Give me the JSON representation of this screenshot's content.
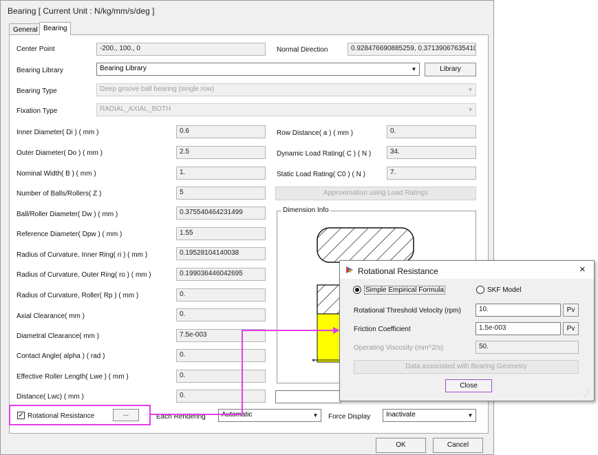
{
  "dialog": {
    "title": "Bearing [ Current Unit : N/kg/mm/s/deg ]",
    "tabs": [
      "General",
      "Bearing"
    ],
    "center_point": {
      "label": "Center Point",
      "value": "-200., 100., 0"
    },
    "normal_direction": {
      "label": "Normal Direction",
      "value": "0.928476690885259, 0.371390676354104,"
    },
    "bearing_library": {
      "label": "Bearing Library",
      "value": "Bearing Library",
      "button": "Library"
    },
    "bearing_type": {
      "label": "Bearing Type",
      "value": "Deep groove ball bearing (single row)"
    },
    "fixation_type": {
      "label": "Fixation Type",
      "value": "RADIAL_AXIAL_BOTH"
    },
    "left_fields": [
      {
        "label": "Inner Diameter( Di ) ( mm )",
        "value": "0.6"
      },
      {
        "label": "Outer Diameter( Do ) ( mm )",
        "value": "2.5"
      },
      {
        "label": "Nominal Width( B ) ( mm )",
        "value": "1."
      },
      {
        "label": "Number of Balls/Rollers( Z )",
        "value": "5"
      },
      {
        "label": "Ball/Roller Diameter( Dw ) ( mm )",
        "value": "0.375540464231499"
      },
      {
        "label": "Reference Diameter( Dpw ) ( mm )",
        "value": "1.55"
      },
      {
        "label": "Radius of Curvature, Inner Ring( ri ) ( mm )",
        "value": "0.19528104140038"
      },
      {
        "label": "Radius of Curvature, Outer Ring( ro ) ( mm )",
        "value": "0.199036446042695"
      },
      {
        "label": "Radius of Curvature, Roller( Rp ) ( mm )",
        "value": "0."
      },
      {
        "label": "Axial Clearance( mm )",
        "value": "0."
      },
      {
        "label": "Diametral Clearance( mm )",
        "value": "7.5e-003"
      },
      {
        "label": "Contact Angle( alpha ) ( rad )",
        "value": "0."
      },
      {
        "label": "Effective Roller Length( Lwe ) ( mm )",
        "value": "0."
      },
      {
        "label": "Distance( Lwc) ( mm )",
        "value": "0."
      }
    ],
    "right_fields": [
      {
        "label": "Row Distance( a ) ( mm )",
        "value": "0."
      },
      {
        "label": "Dynamic Load Rating( C ) ( N )",
        "value": "34."
      },
      {
        "label": "Static Load Rating( C0 ) ( N )",
        "value": "7."
      }
    ],
    "approx_button": "Approximation using Load Ratings",
    "dimension_group": "Dimension Info",
    "rotational_resistance": {
      "label": "Rotational Resistance",
      "checked": true,
      "button": "..."
    },
    "each_rendering": {
      "label": "Each Rendering",
      "value": "Automatic"
    },
    "force_display": {
      "label": "Force Display",
      "value": "Inactivate"
    },
    "ok": "OK",
    "cancel": "Cancel"
  },
  "popup": {
    "title": "Rotational Resistance",
    "close_x": "×",
    "option_simple": "Simple Empirical Formula",
    "option_skf": "SKF Model",
    "selected": "Simple Empirical Formula",
    "threshold": {
      "label": "Rotational Threshold Velocity (rpm)",
      "value": "10.",
      "button": "Pv"
    },
    "friction": {
      "label": "Friction Coefficient",
      "value": "1.5e-003",
      "button": "Pv"
    },
    "viscosity": {
      "label": "Operating Viscosity (mm^2/s)",
      "value": "50."
    },
    "geometry_button": "Data associated with Bearing Geometry",
    "close_button": "Close"
  },
  "colors": {
    "highlight": "#e23de6",
    "dialog_bg": "#f0f0f0",
    "yellow": "#ffff00"
  }
}
